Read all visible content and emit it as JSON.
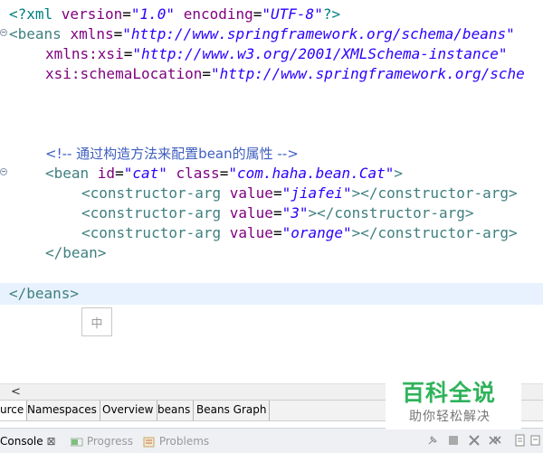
{
  "editor": {
    "line1": {
      "open": "<?xml ",
      "attr1": "version",
      "val1": "\"1.0\"",
      "attr2": "encoding",
      "val2": "\"UTF-8\"",
      "close": "?>"
    },
    "line2": {
      "open": "<beans ",
      "attr": "xmlns",
      "val": "\"http://www.springframework.org/schema/beans\""
    },
    "line3": {
      "attr": "xmlns:xsi",
      "val": "\"http://www.w3.org/2001/XMLSchema-instance\""
    },
    "line4": {
      "attr": "xsi:schemaLocation",
      "val": "\"http://www.springframework.org/sche"
    },
    "comment": "<!-- 通过构造方法来配置bean的属性 -->",
    "bean": {
      "open": "<bean ",
      "attr_id": "id",
      "val_id": "\"cat\"",
      "attr_class": "class",
      "val_class": "\"com.haha.bean.Cat\"",
      "close": ">"
    },
    "ctor_open": "<constructor-arg ",
    "ctor_attr": "value",
    "ctor_close_tag": "></constructor-arg>",
    "ctor_values": [
      "\"jiafei\"",
      "\"3\"",
      "\"orange\""
    ],
    "bean_end": "</bean>",
    "beans_end": "</beans>",
    "ime_char": "中"
  },
  "hscroll": {
    "left_arrow": "<"
  },
  "tabs": [
    "urce",
    "Namespaces",
    "Overview",
    "beans",
    "Beans Graph"
  ],
  "console_bar": {
    "console_label": "Console",
    "console_close": "⊠",
    "progress_label": "Progress",
    "problems_label": "Problems"
  },
  "watermark": {
    "title": "百科全说",
    "subtitle": "助你轻松解决"
  },
  "colors": {
    "tag": "#3f7f7f",
    "attribute": "#7f007f",
    "value": "#2a00ff",
    "comment": "#3f5fbf",
    "current_line": "#e8f2fe",
    "watermark_green": "#2fb35a"
  }
}
